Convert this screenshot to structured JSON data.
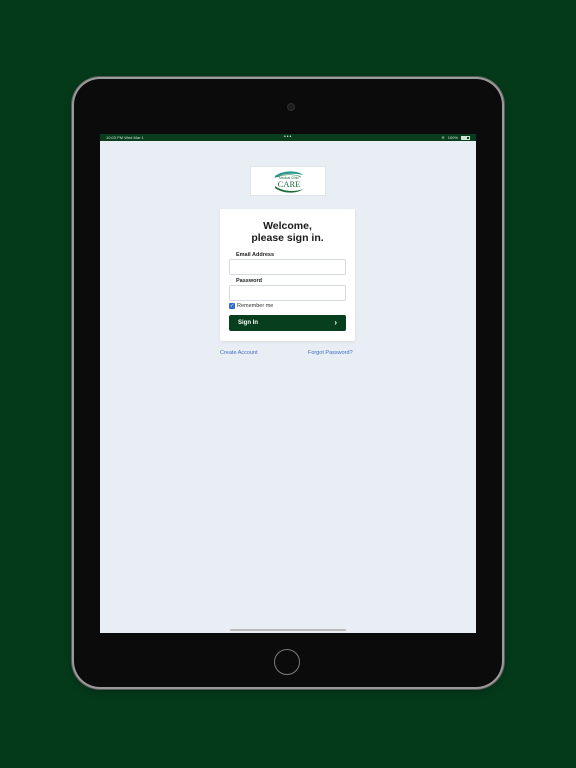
{
  "status_bar": {
    "time": "10:03 PM",
    "date": "Wed Mar 1",
    "dots": "•••",
    "battery": "100%"
  },
  "logo": {
    "top_text": "Medical Clinic",
    "brand": "CARE"
  },
  "login": {
    "heading_line1": "Welcome,",
    "heading_line2": "please sign in.",
    "email_label": "Email Address",
    "email_value": "",
    "password_label": "Password",
    "password_value": "",
    "remember_label": "Remember me",
    "remember_checked": true,
    "signin_label": "Sign In"
  },
  "links": {
    "create_account": "Create Account",
    "forgot_password": "Forgot Password?"
  },
  "colors": {
    "background": "#04391a",
    "accent": "#073e1d",
    "link": "#3f6fc4",
    "screen": "#e9edf4",
    "logo_teal": "#2a9a8c",
    "logo_green": "#1f6a3a"
  },
  "icons": {
    "checkbox": "checkmark-icon",
    "signin_arrow": "chevron-right-icon",
    "camera": "camera-icon",
    "home": "home-button-icon"
  }
}
